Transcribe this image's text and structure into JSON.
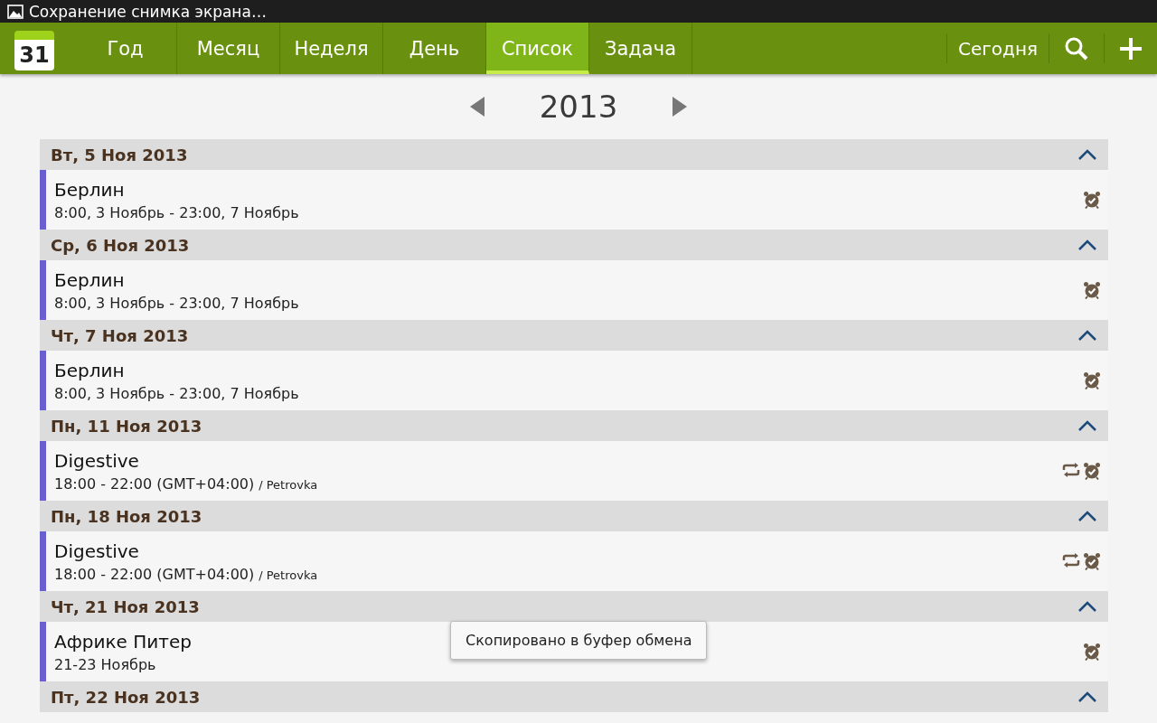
{
  "status_bar": {
    "notification": "Сохранение снимка экрана…"
  },
  "toolbar": {
    "app_icon_day": "31",
    "tabs": [
      {
        "label": "Год",
        "selected": false
      },
      {
        "label": "Месяц",
        "selected": false
      },
      {
        "label": "Неделя",
        "selected": false
      },
      {
        "label": "День",
        "selected": false
      },
      {
        "label": "Список",
        "selected": true
      },
      {
        "label": "Задача",
        "selected": false
      }
    ],
    "today_button": "Сегодня"
  },
  "year_nav": {
    "year": "2013"
  },
  "groups": [
    {
      "date": "Вт, 5 Ноя 2013",
      "expanded": true,
      "events": [
        {
          "title": "Берлин",
          "time": "8:00, 3 Ноябрь - 23:00, 7 Ноябрь",
          "color": "#6a5fd0",
          "repeat": false,
          "alarm": true
        }
      ]
    },
    {
      "date": "Ср, 6 Ноя 2013",
      "expanded": true,
      "events": [
        {
          "title": "Берлин",
          "time": "8:00, 3 Ноябрь - 23:00, 7 Ноябрь",
          "color": "#6a5fd0",
          "repeat": false,
          "alarm": true
        }
      ]
    },
    {
      "date": "Чт, 7 Ноя 2013",
      "expanded": true,
      "events": [
        {
          "title": "Берлин",
          "time": "8:00, 3 Ноябрь - 23:00, 7 Ноябрь",
          "color": "#6a5fd0",
          "repeat": false,
          "alarm": true
        }
      ]
    },
    {
      "date": "Пн, 11 Ноя 2013",
      "expanded": true,
      "events": [
        {
          "title": "Digestive",
          "time": "18:00 - 22:00 (GMT+04:00)",
          "location": "/ Petrovka",
          "color": "#6a5fd0",
          "repeat": true,
          "alarm": true
        }
      ]
    },
    {
      "date": "Пн, 18 Ноя 2013",
      "expanded": true,
      "events": [
        {
          "title": "Digestive",
          "time": "18:00 - 22:00 (GMT+04:00)",
          "location": "/ Petrovka",
          "color": "#6a5fd0",
          "repeat": true,
          "alarm": true
        }
      ]
    },
    {
      "date": "Чт, 21 Ноя 2013",
      "expanded": true,
      "events": [
        {
          "title": "Африке Питер",
          "time": "21-23 Ноябрь",
          "color": "#6a5fd0",
          "repeat": false,
          "alarm": true
        }
      ]
    },
    {
      "date": "Пт, 22 Ноя 2013",
      "expanded": true
    }
  ],
  "toast": "Скопировано в буфер обмена"
}
